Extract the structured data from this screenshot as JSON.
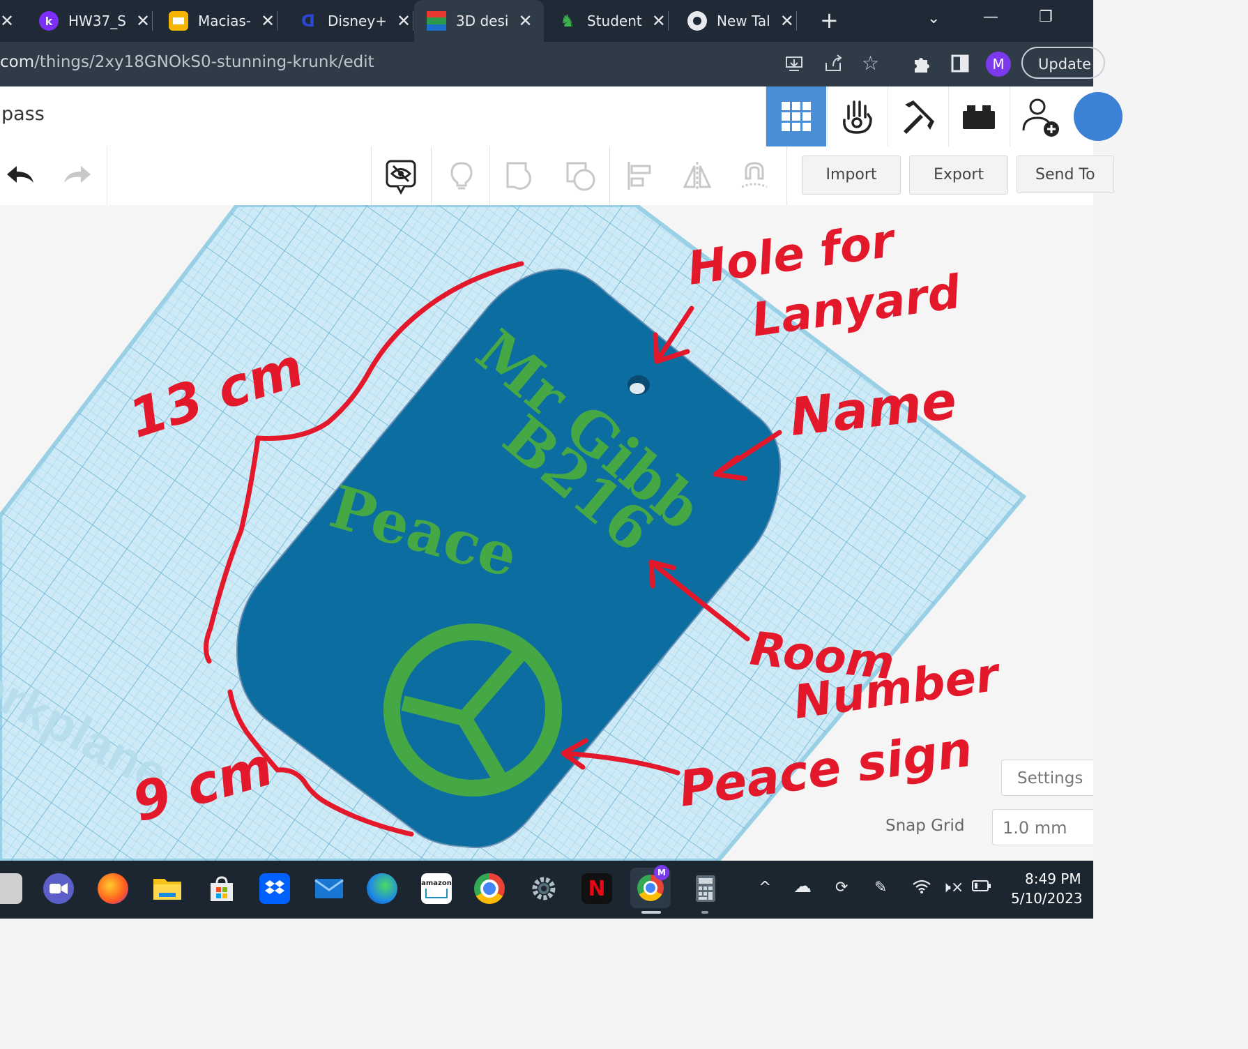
{
  "browser": {
    "tabs": [
      {
        "label": "HW37_S",
        "icon": "kami-icon"
      },
      {
        "label": "Macias-",
        "icon": "slides-icon"
      },
      {
        "label": "Disney+",
        "icon": "disney-icon"
      },
      {
        "label": "3D desi",
        "icon": "tinkercad-icon",
        "active": true
      },
      {
        "label": "Student",
        "icon": "student-icon"
      },
      {
        "label": "New Tal",
        "icon": "chrome-icon"
      }
    ],
    "url_host": "com",
    "url_path": "/things/2xy18GNOkS0-stunning-krunk/edit",
    "avatar_letter": "M",
    "update_label": "Update"
  },
  "app": {
    "project_title": "pass",
    "toolbar": {
      "import_label": "Import",
      "export_label": "Export",
      "send_label": "Send To"
    },
    "settings_label": "Settings",
    "snap_grid_label": "Snap Grid",
    "snap_grid_value": "1.0 mm",
    "workplane_label": "Workplane"
  },
  "design": {
    "plate_color": "#0c6da1",
    "text_color": "#46a845",
    "name_text": "Mr Gibb",
    "room_text": "B216",
    "word_text": "Peace"
  },
  "annotations": {
    "color": "#e3192b",
    "hole_line1": "Hole for",
    "hole_line2": "Lanyard",
    "name": "Name",
    "room_line1": "Room",
    "room_line2": "Number",
    "peace_sign": "Peace sign",
    "height": "13 cm",
    "width": "9 cm"
  },
  "taskbar": {
    "time": "8:49 PM",
    "date": "5/10/2023"
  }
}
